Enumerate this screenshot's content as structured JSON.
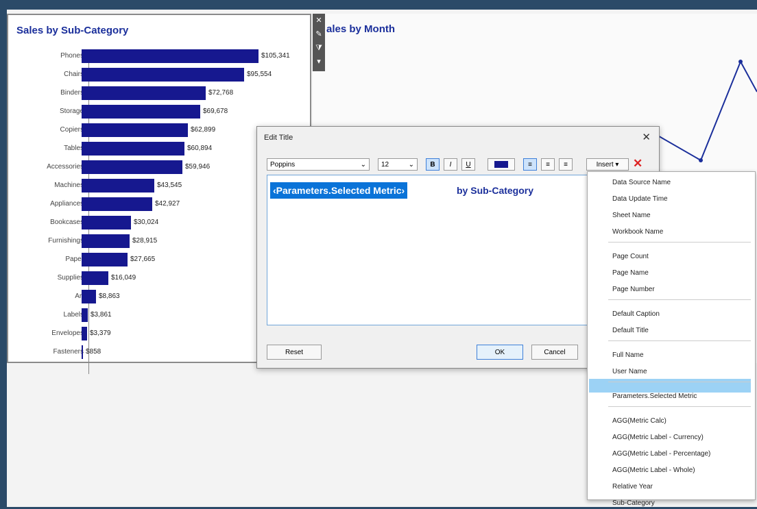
{
  "bar_sheet": {
    "title": "Sales by Sub-Category",
    "rows": [
      {
        "label": "Phones",
        "value": "$105,341",
        "frac": 1.0
      },
      {
        "label": "Chairs",
        "value": "$95,554",
        "frac": 0.92
      },
      {
        "label": "Binders",
        "value": "$72,768",
        "frac": 0.7
      },
      {
        "label": "Storage",
        "value": "$69,678",
        "frac": 0.67
      },
      {
        "label": "Copiers",
        "value": "$62,899",
        "frac": 0.6
      },
      {
        "label": "Tables",
        "value": "$60,894",
        "frac": 0.58
      },
      {
        "label": "Accessories",
        "value": "$59,946",
        "frac": 0.57
      },
      {
        "label": "Machines",
        "value": "$43,545",
        "frac": 0.41
      },
      {
        "label": "Appliances",
        "value": "$42,927",
        "frac": 0.4
      },
      {
        "label": "Bookcases",
        "value": "$30,024",
        "frac": 0.28
      },
      {
        "label": "Furnishings",
        "value": "$28,915",
        "frac": 0.27
      },
      {
        "label": "Paper",
        "value": "$27,665",
        "frac": 0.26
      },
      {
        "label": "Supplies",
        "value": "$16,049",
        "frac": 0.15
      },
      {
        "label": "Art",
        "value": "$8,863",
        "frac": 0.08
      },
      {
        "label": "Labels",
        "value": "$3,861",
        "frac": 0.035
      },
      {
        "label": "Envelopes",
        "value": "$3,379",
        "frac": 0.031
      },
      {
        "label": "Fasteners",
        "value": "$858",
        "frac": 0.008
      }
    ]
  },
  "month_sheet": {
    "title": "ales by Month"
  },
  "dialog": {
    "title": "Edit Title",
    "font": "Poppins",
    "size": "12",
    "insert_label": "Insert ▾",
    "param_text": "‹Parameters.Selected Metric›",
    "rest_text": "by Sub-Category",
    "reset": "Reset",
    "ok": "OK",
    "cancel": "Cancel"
  },
  "insert_menu": {
    "groups": [
      [
        "Data Source Name",
        "Data Update Time",
        "Sheet Name",
        "Workbook Name"
      ],
      [
        "Page Count",
        "Page Name",
        "Page Number"
      ],
      [
        "Default Caption",
        "Default Title"
      ],
      [
        "Full Name",
        "User Name"
      ],
      [
        "Parameters.Selected Metric"
      ],
      [
        "AGG(Metric Calc)",
        "AGG(Metric Label - Currency)",
        "AGG(Metric Label - Percentage)",
        "AGG(Metric Label - Whole)",
        "Relative Year",
        "Sub-Category"
      ]
    ],
    "highlighted": "Parameters.Selected Metric"
  },
  "colors": {
    "accent": "#16188f",
    "selection": "#0a73d8",
    "highlight": "#9cd2f5",
    "background": "#2b4a68"
  }
}
